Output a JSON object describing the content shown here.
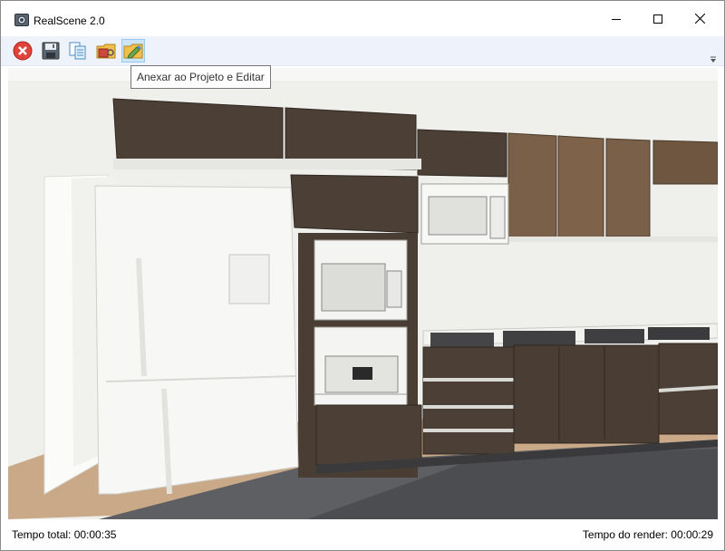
{
  "window": {
    "title": "RealScene 2.0"
  },
  "toolbar": {
    "buttons": [
      {
        "icon": "close-circle-icon",
        "color": "#e0433a"
      },
      {
        "icon": "save-icon"
      },
      {
        "icon": "copy-icon"
      },
      {
        "icon": "attach-folder-icon"
      },
      {
        "icon": "attach-edit-folder-icon",
        "active": true
      }
    ],
    "tooltip": "Anexar ao Projeto e Editar"
  },
  "viewport": {
    "description_icon": "rendered-kitchen-image"
  },
  "status": {
    "total_time": "Tempo total: 00:00:35",
    "render_time": "Tempo do render: 00:00:29"
  },
  "colors": {
    "cabinet_dark": "#4c4036",
    "cabinet_wood": "#7a6048",
    "accent_active": "#cce4f7"
  }
}
